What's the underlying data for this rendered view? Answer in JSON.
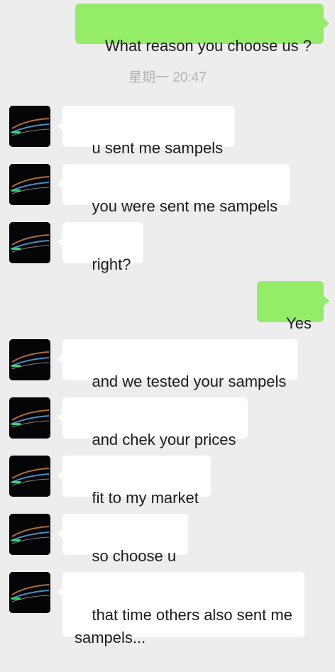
{
  "chat": {
    "timestamp": "星期一 20:47",
    "messages": [
      {
        "side": "out",
        "text": "What reason you choose us ?"
      },
      {
        "side": "in",
        "text": "u sent me sampels"
      },
      {
        "side": "in",
        "text": "you were sent me sampels"
      },
      {
        "side": "in",
        "text": "right?"
      },
      {
        "side": "out",
        "text": "Yes"
      },
      {
        "side": "in",
        "text": "and we tested your sampels"
      },
      {
        "side": "in",
        "text": "and chek your prices"
      },
      {
        "side": "in",
        "text": "fit to my market"
      },
      {
        "side": "in",
        "text": "so choose u"
      },
      {
        "side": "in",
        "text": "that time others also sent me\nsampels..."
      }
    ]
  },
  "colors": {
    "background": "#ededed",
    "incoming_bubble": "#ffffff",
    "outgoing_bubble": "#95ec69",
    "timestamp_text": "#b2b2b2"
  },
  "icons": {
    "contact_avatar": "dark-light-streaks-avatar-icon"
  }
}
